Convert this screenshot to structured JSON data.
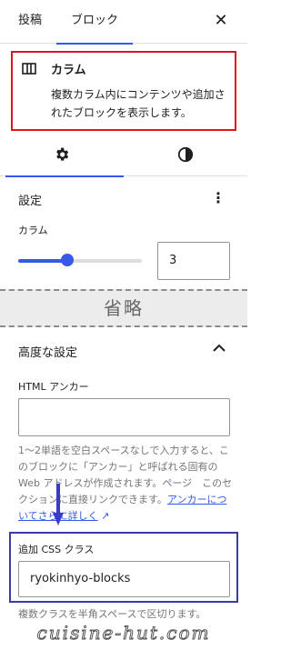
{
  "tabs": {
    "post": "投稿",
    "block": "ブロック",
    "close_icon": "close-icon"
  },
  "block_card": {
    "icon": "columns-icon",
    "title": "カラム",
    "description": "複数カラム内にコンテンツや追加されたブロックを表示します。"
  },
  "inspector_tabs": [
    {
      "icon": "gear-icon",
      "selected": true
    },
    {
      "icon": "styles-icon",
      "selected": false
    }
  ],
  "settings": {
    "title": "設定",
    "options_icon": "more-vertical-icon",
    "columns_label": "カラム",
    "columns_value": "3",
    "slider_fraction": 0.4
  },
  "omission_text": "省略",
  "advanced": {
    "title": "高度な設定",
    "toggle_icon": "chevron-up-icon",
    "html_anchor_label": "HTML アンカー",
    "html_anchor_value": "",
    "help_lines": [
      "1〜2単語を空白スペースなしで入力すると、このブロックに「アンカー」と呼ばれる固有の Web アドレスが作成されます。ページにこのセクションに直接リンクできます。"
    ],
    "help_text": "1〜2単語を空白スペースなしで入力すると、このブロックに「アンカー」と呼ばれる固有の Web アドレスが作成されます。ページ　このセクションに直接リンクできます。",
    "help_link": "アンカーについてさらに詳しく",
    "help_link_icon": "external-icon",
    "css_class_label": "追加 CSS クラス",
    "css_class_value": "ryokinhyo-blocks",
    "css_help": "複数クラスを半角スペースで区切ります。"
  },
  "watermark": "cuisine-hut.com",
  "colors": {
    "accent": "#3858e9",
    "red_frame": "#e0141e",
    "blue_frame": "#3b3ba8",
    "arrow": "#3a3ac8"
  }
}
